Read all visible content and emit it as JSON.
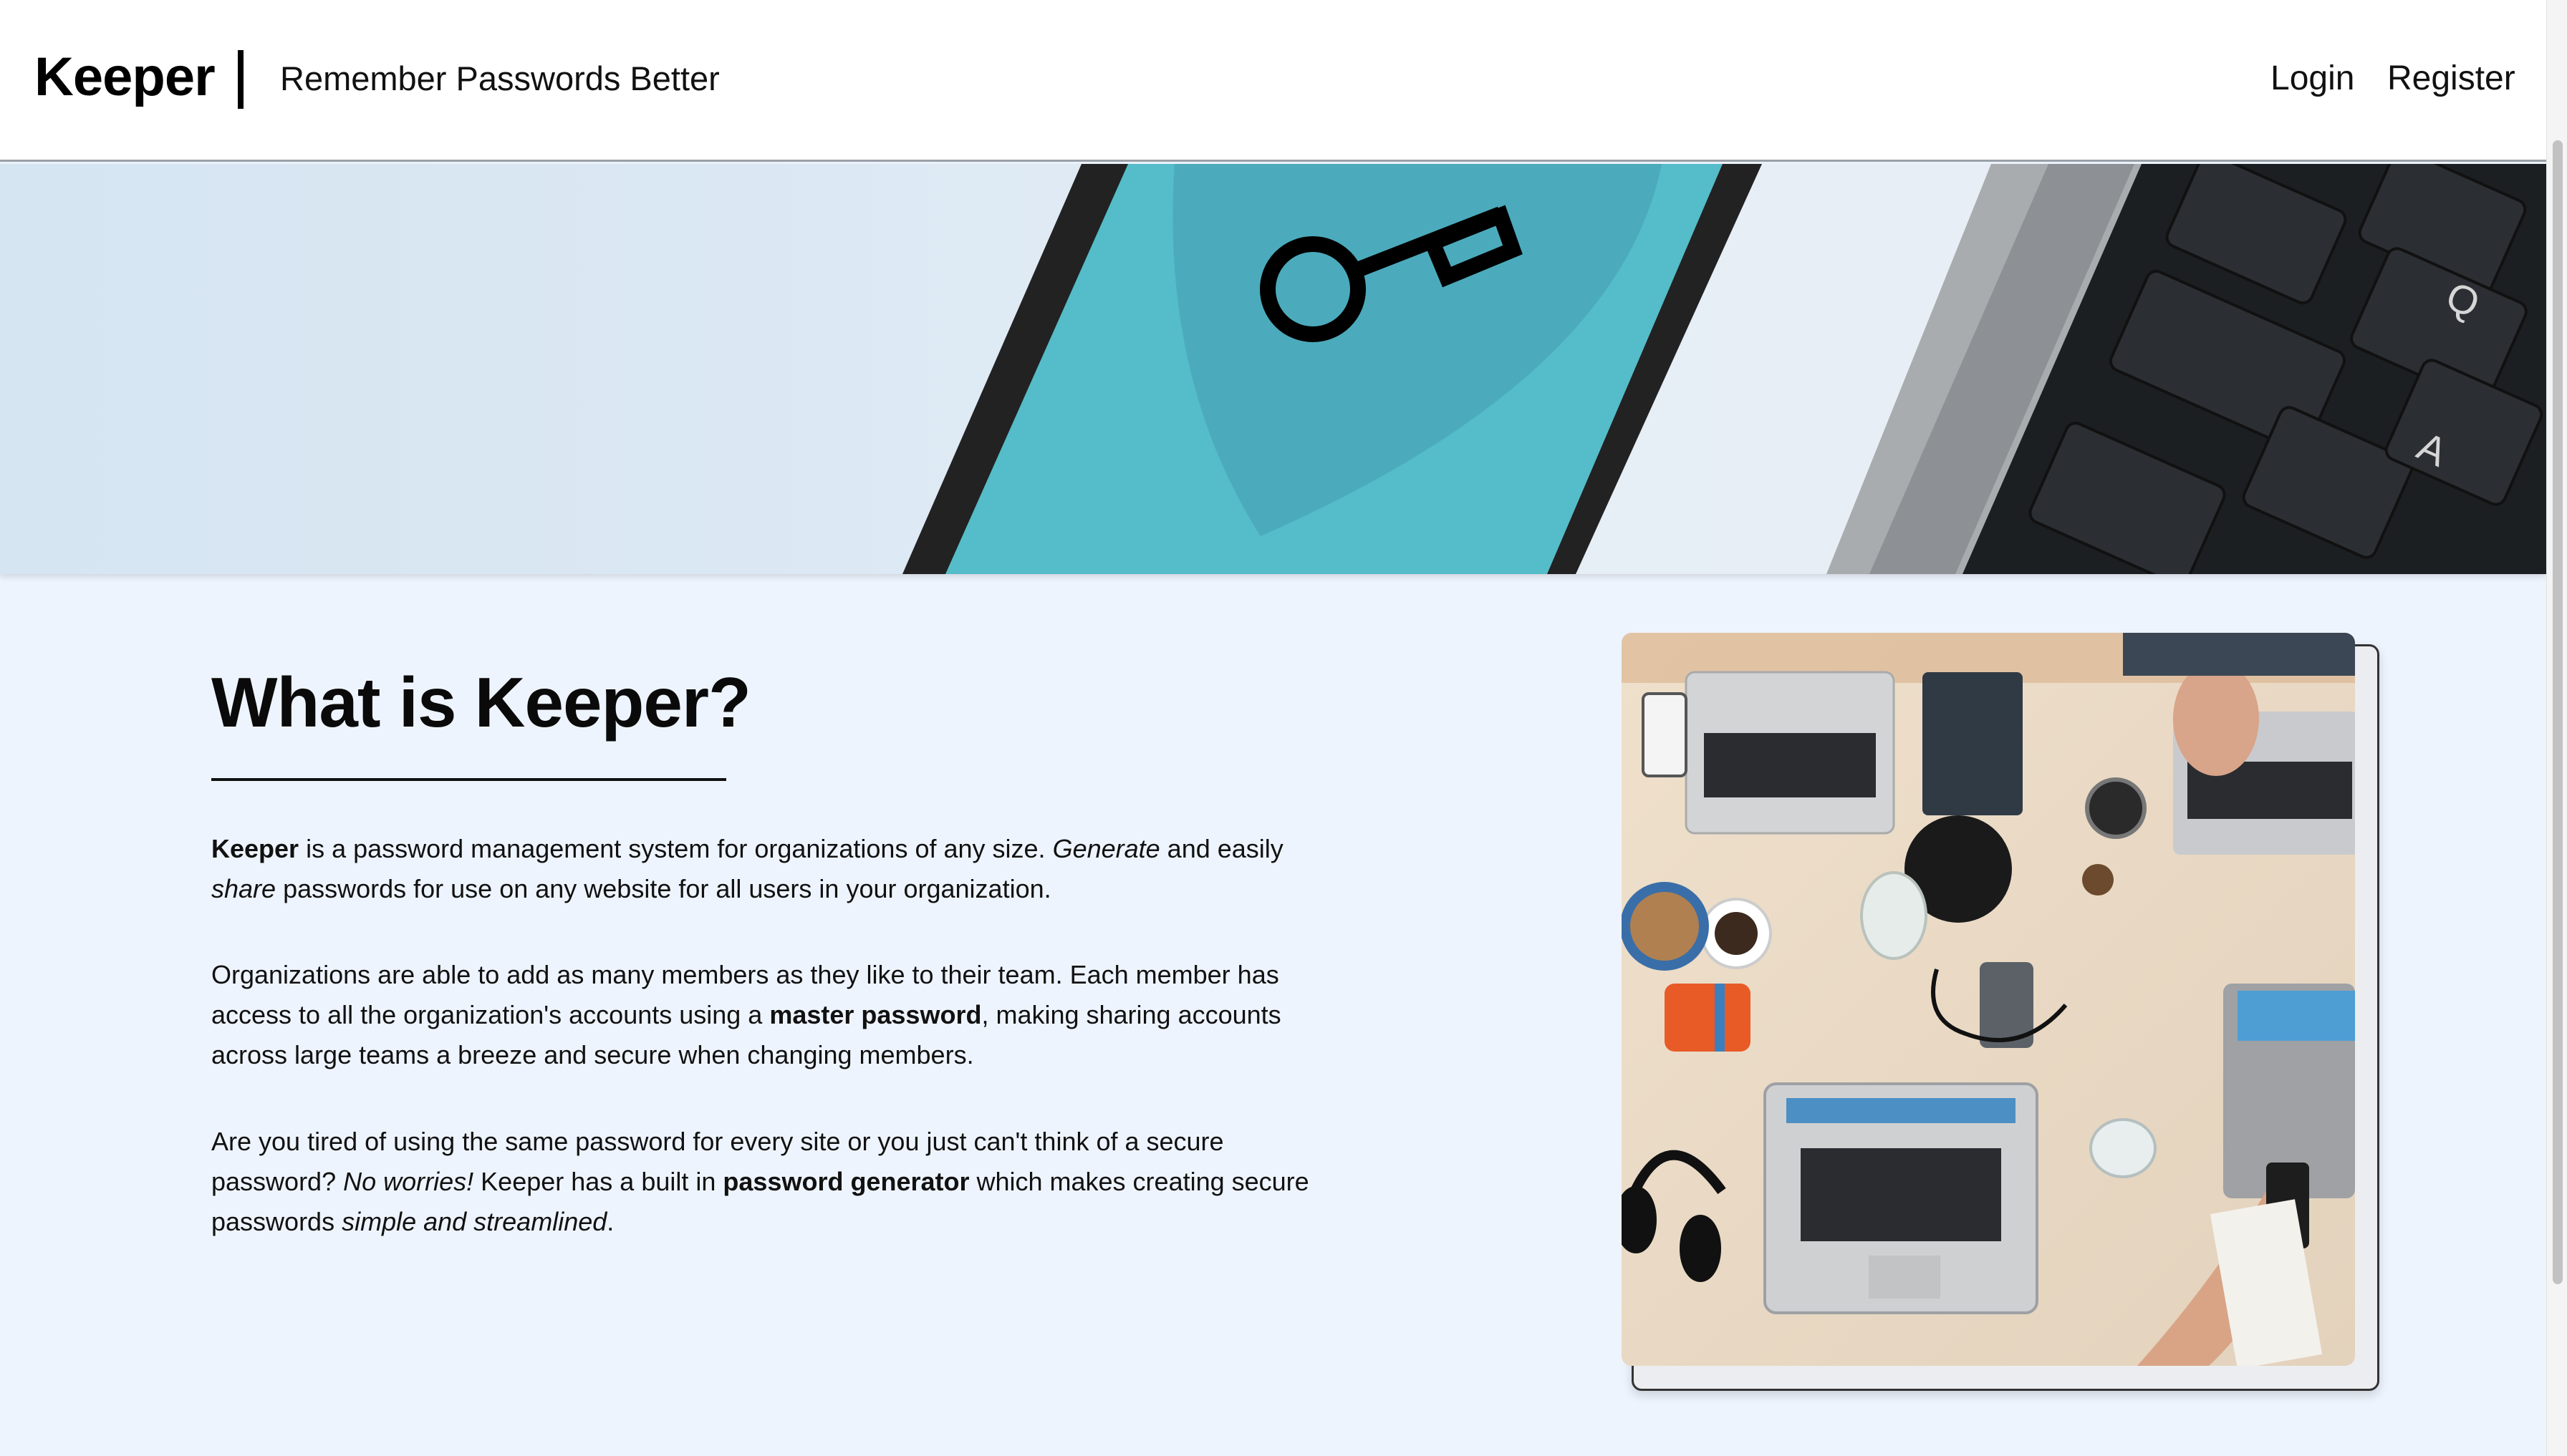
{
  "header": {
    "brand": "Keeper",
    "tagline": "Remember Passwords Better",
    "nav": {
      "login": "Login",
      "register": "Register"
    }
  },
  "hero": {
    "image": "key-on-phone-and-keyboard",
    "key_labels": [
      "Q",
      "A"
    ]
  },
  "main": {
    "heading": "What is Keeper?",
    "paragraphs": [
      {
        "runs": [
          {
            "text": "Keeper",
            "style": "bold"
          },
          {
            "text": " is a password management system for organizations of any size. ",
            "style": "normal"
          },
          {
            "text": "Generate",
            "style": "italic"
          },
          {
            "text": " and easily ",
            "style": "normal"
          },
          {
            "text": "share",
            "style": "italic"
          },
          {
            "text": " passwords for use on any website for all users in your organization.",
            "style": "normal"
          }
        ]
      },
      {
        "runs": [
          {
            "text": "Organizations are able to add as many members as they like to their team. Each member has access to all the organization's accounts using a ",
            "style": "normal"
          },
          {
            "text": "master password",
            "style": "bold"
          },
          {
            "text": ", making sharing accounts across large teams a breeze and secure when changing members.",
            "style": "normal"
          }
        ]
      },
      {
        "runs": [
          {
            "text": "Are you tired of using the same password for every site or you just can't think of a secure password? ",
            "style": "normal"
          },
          {
            "text": "No worries!",
            "style": "italic"
          },
          {
            "text": " Keeper has a built in ",
            "style": "normal"
          },
          {
            "text": "password generator",
            "style": "bold"
          },
          {
            "text": " which makes creating secure passwords ",
            "style": "normal"
          },
          {
            "text": "simple and streamlined",
            "style": "italic"
          },
          {
            "text": ".",
            "style": "normal"
          }
        ]
      }
    ],
    "photo": "team-desk-with-laptops"
  },
  "colors": {
    "page_bg": "#eef4fd",
    "header_bg": "#ffffff",
    "phone_screen": "#55bcc9",
    "keyboard": "#1c1f22"
  }
}
